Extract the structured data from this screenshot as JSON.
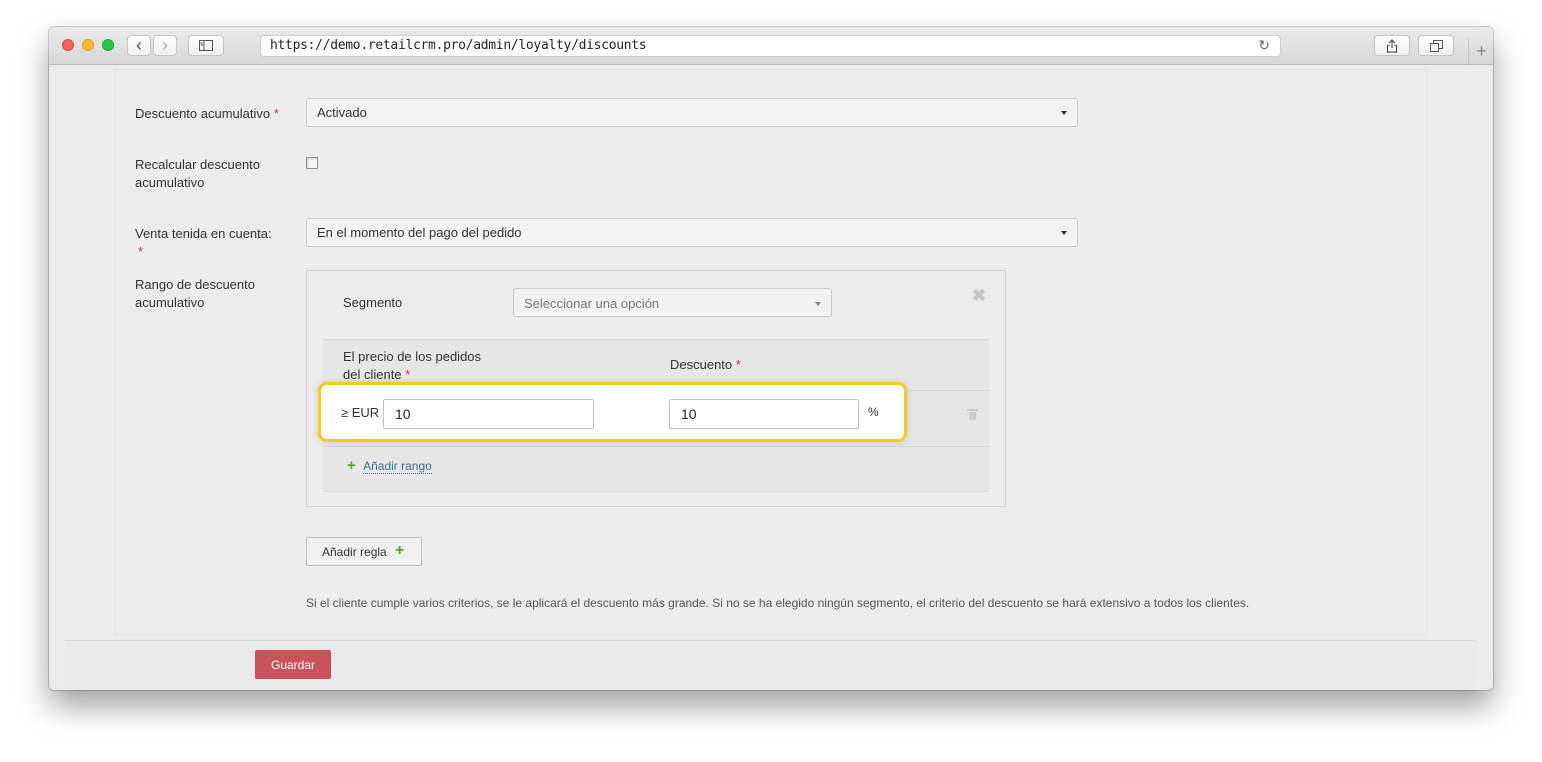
{
  "browser": {
    "url": "https://demo.retailcrm.pro/admin/loyalty/discounts",
    "back_glyph": "‹",
    "forward_glyph": "›",
    "new_tab_glyph": "+"
  },
  "form": {
    "accumulative": {
      "label": "Descuento acumulativo",
      "required_mark": "*",
      "value": "Activado"
    },
    "recalculate": {
      "label_line1": "Recalcular descuento",
      "label_line2": "acumulativo",
      "checked": false
    },
    "sale_counted": {
      "label": "Venta tenida en cuenta:",
      "required_mark": "*",
      "value": "En el momento del pago del pedido"
    },
    "range": {
      "label_line1": "Rango de descuento",
      "label_line2": "acumulativo",
      "segment_label": "Segmento",
      "segment_placeholder": "Seleccionar una opción",
      "close_glyph": "✖",
      "price_header_line1": "El precio de los pedidos",
      "price_header_line2": "del cliente",
      "discount_header": "Descuento",
      "required_mark": "*",
      "rows": [
        {
          "currency_prefix": "≥ EUR",
          "price": "10",
          "discount": "10",
          "unit": "%"
        }
      ],
      "add_range_plus": "+",
      "add_range_label": "Añadir rango"
    },
    "add_rule_label": "Añadir regla",
    "add_rule_plus": "+",
    "note": "Si el cliente cumple varios criterios, se le aplicará el descuento más grande. Si no se ha elegido ningún segmento, el criterio del descuento se hará extensivo a todos los clientes."
  },
  "footer": {
    "save_label": "Guardar"
  },
  "colors": {
    "highlight_border": "#f5cc1e",
    "save_button": "#c9535c",
    "required": "#c6353f",
    "add_icon": "#5aa02c",
    "link": "#3f6d95"
  }
}
